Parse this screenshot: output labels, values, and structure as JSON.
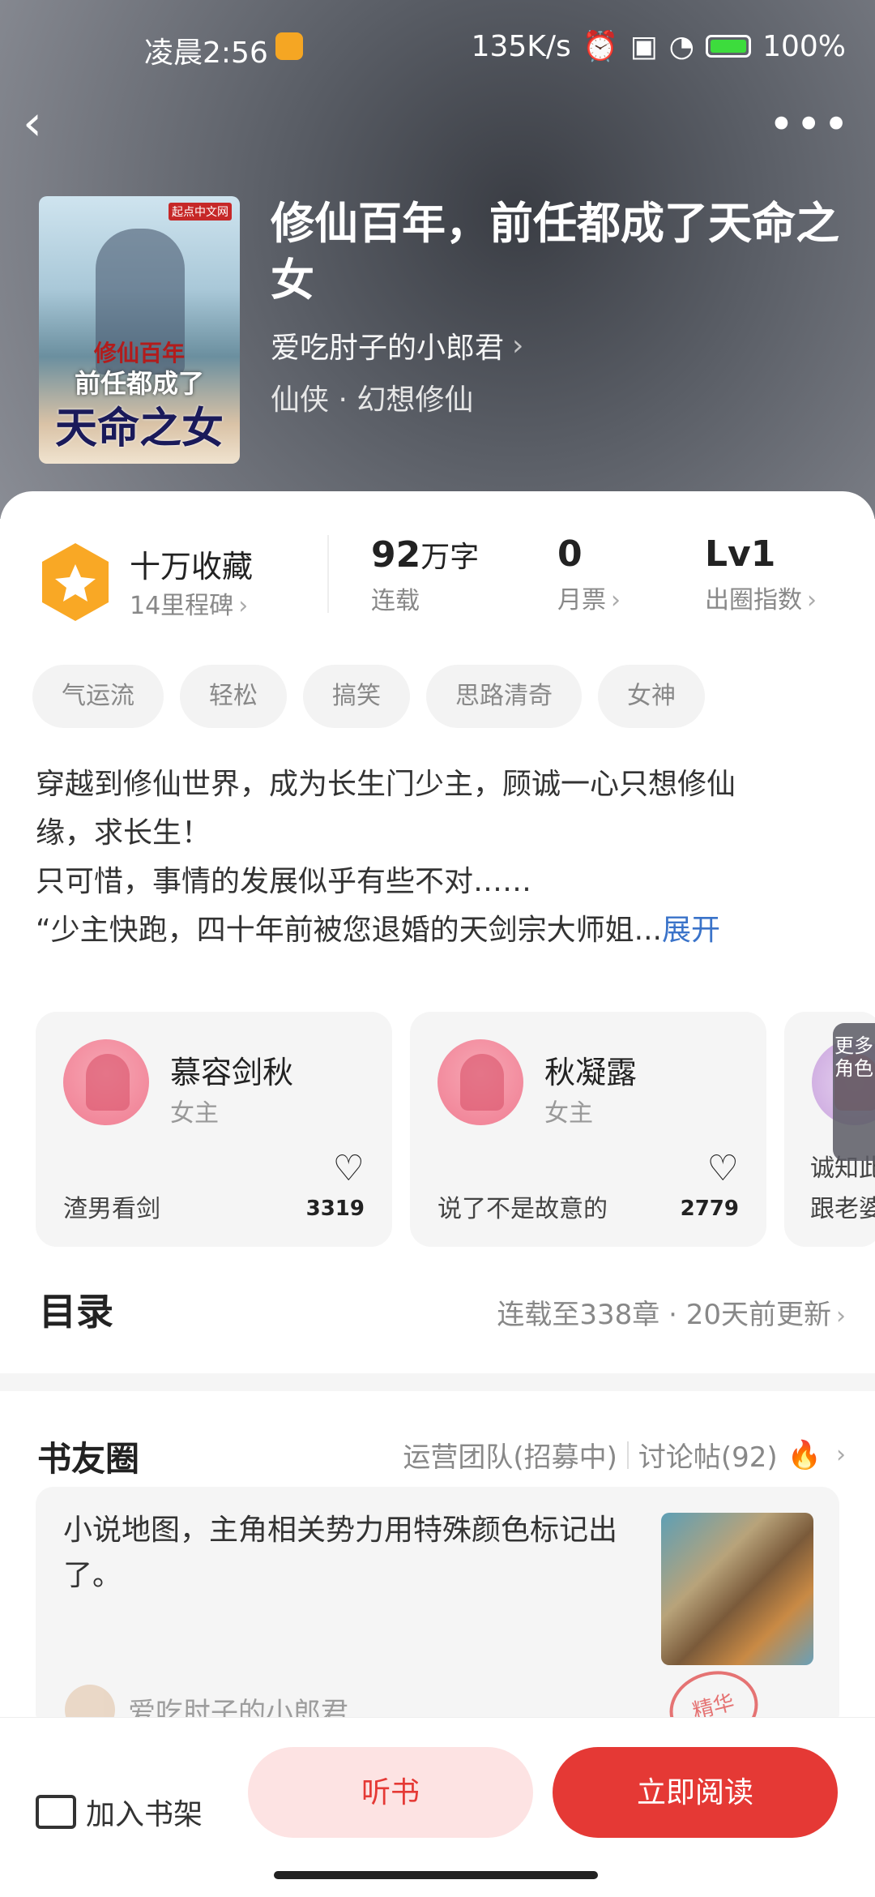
{
  "status": {
    "time": "凌晨2:56",
    "speed": "135K/s",
    "battery": "100%"
  },
  "book": {
    "title": "修仙百年，前任都成了天命之女",
    "author": "爱吃肘子的小郎君",
    "genre": "仙侠 · 幻想修仙",
    "cover": {
      "line1": "修仙百年",
      "line2": "前任都成了",
      "line3": "天命之女",
      "badge": "起点中文网"
    }
  },
  "stats": {
    "medal_title": "十万收藏",
    "medal_sub": "14里程碑",
    "words_num": "92",
    "words_unit": "万字",
    "words_label": "连载",
    "tickets_num": "0",
    "tickets_label": "月票",
    "level_num": "Lv1",
    "level_label": "出圈指数"
  },
  "tags": [
    "气运流",
    "轻松",
    "搞笑",
    "思路清奇",
    "女神"
  ],
  "description": {
    "line1": "穿越到修仙世界，成为长生门少主，顾诚一心只想修仙",
    "line2": "缘，求长生！",
    "line3": "只可惜，事情的发展似乎有些不对……",
    "line4": "“少主快跑，四十年前被您退婚的天剑宗大师姐...",
    "expand": "展开"
  },
  "characters": [
    {
      "name": "慕容剑秋",
      "role": "女主",
      "quote": "渣男看剑",
      "likes": "3319"
    },
    {
      "name": "秋凝露",
      "role": "女主",
      "quote": "说了不是故意的",
      "likes": "2779"
    },
    {
      "quote": "诚知此",
      "quote2": "跟老婆"
    }
  ],
  "more_roles": "更多角色",
  "toc": {
    "title": "目录",
    "status": "连载至338章 · 20天前更新"
  },
  "circle": {
    "title": "书友圈",
    "team": "运营团队(招募中)",
    "threads": "讨论帖(92)",
    "post_text": "小说地图，主角相关势力用特殊颜色标记出了。",
    "post_author": "爱吃肘子的小郎君",
    "stamp": "精华"
  },
  "bottom": {
    "shelf": "加入书架",
    "listen": "听书",
    "read": "立即阅读"
  }
}
